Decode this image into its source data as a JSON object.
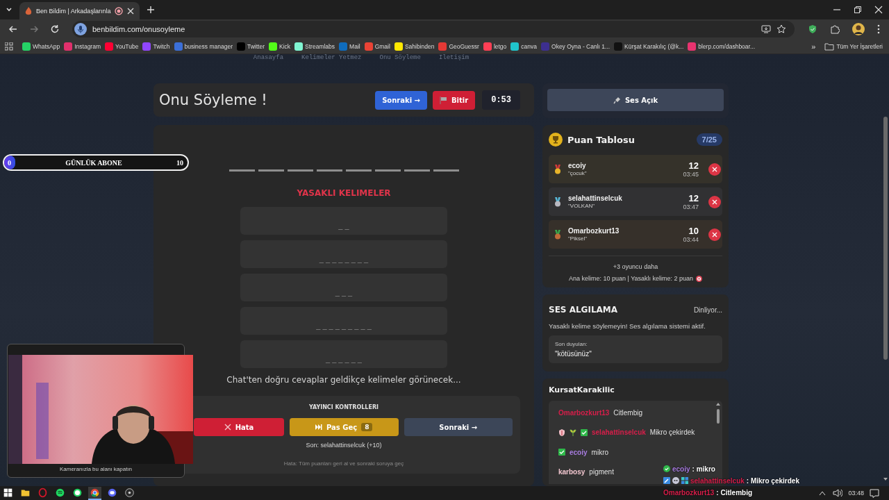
{
  "browser": {
    "tab": {
      "title": "Ben Bildim | Arkadaşlarınla",
      "recording": true
    },
    "address": "benbildim.com/onusoyleme",
    "bookmarks": [
      {
        "label": "WhatsApp",
        "color": "#25d366"
      },
      {
        "label": "Instagram",
        "color": "#e1306c"
      },
      {
        "label": "YouTube",
        "color": "#ff0033"
      },
      {
        "label": "Twitch",
        "color": "#9146ff"
      },
      {
        "label": "business manager",
        "color": "#3b6fd8"
      },
      {
        "label": "Twitter",
        "color": "#000000"
      },
      {
        "label": "Kick",
        "color": "#53fc18"
      },
      {
        "label": "Streamlabs",
        "color": "#80f5d2"
      },
      {
        "label": "Mail",
        "color": "#0f6cbd"
      },
      {
        "label": "Gmail",
        "color": "#ea4335"
      },
      {
        "label": "Sahibinden",
        "color": "#ffe800"
      },
      {
        "label": "GeoGuessr",
        "color": "#e53935"
      },
      {
        "label": "letgo",
        "color": "#ff3f55"
      },
      {
        "label": "canva",
        "color": "#20c4cb"
      },
      {
        "label": "Okey Oyna - Canlı 1...",
        "color": "#3d2f8f"
      },
      {
        "label": "Kürşat Karakılıç (@k...",
        "color": "#111111"
      },
      {
        "label": "blerp.com/dashboar...",
        "color": "#e8336f"
      }
    ],
    "more": "»",
    "all_bookmarks": "Tüm Yer İşaretleri"
  },
  "nav": [
    "Anasayfa",
    "Kelimeler Yetmez",
    "Onu Söyleme",
    "İletişim"
  ],
  "game": {
    "title": "Onu Söyleme !",
    "next_button": "Sonraki →",
    "finish_button": "Bitir",
    "timer": "0:53",
    "letters": [
      {
        "revealed": false
      },
      {
        "revealed": false
      },
      {
        "revealed": false
      },
      {
        "revealed": false
      },
      {
        "revealed": false
      },
      {
        "revealed": false
      },
      {
        "revealed": false
      },
      {
        "revealed": false
      }
    ],
    "forbidden_title": "YASAKLI KELIMELER",
    "forbidden_words": [
      "_ _",
      "_ _ _ _ _ _ _ _",
      "_ _ _",
      "_ _ _ _ _ _ _ _ _",
      "_ _ _ _ _ _"
    ],
    "hint": "Chat'ten doğru cevaplar geldikçe kelimeler görünecek...",
    "controls": {
      "title": "YAYINCI KONTROLLERI",
      "buttons": [
        {
          "kind": "error",
          "label": "Hata"
        },
        {
          "kind": "pass",
          "label": "Pas Geç",
          "count": "8"
        },
        {
          "kind": "next",
          "label": "Sonraki →"
        }
      ],
      "last": "Son: selahattinselcuk (+10)",
      "note": "Hata: Tüm puanları geri al ve sonraki soruya geç"
    }
  },
  "sidebar": {
    "sound_button": "Ses Açık",
    "leaderboard": {
      "title": "Puan Tablosu",
      "count": "7/25",
      "entries": [
        {
          "kind": "gold",
          "name": "ecoiy",
          "word": "\"çocuk\"",
          "score": "12",
          "time": "03:45"
        },
        {
          "kind": "silver",
          "name": "selahattinselcuk",
          "word": "\"VOLKAN\"",
          "score": "12",
          "time": "03:47"
        },
        {
          "kind": "bronze",
          "name": "Omarbozkurt13",
          "word": "\"Piksel\"",
          "score": "10",
          "time": "03:44"
        }
      ],
      "more": "+3 oyuncu daha",
      "rules": "Ana kelime: 10 puan | Yasaklı kelime: 2 puan"
    },
    "voice": {
      "title": "SES ALGILAMA",
      "status": "Dinliyor...",
      "text": "Yasaklı kelime söylemeyin! Ses algılama sistemi aktif.",
      "last_label": "Son duyulan:",
      "last_heard": "\"kötüsünüz\""
    },
    "chat": {
      "title": "KursatKarakilic",
      "messages": [
        {
          "user": "Omarbozkurt13",
          "color": "#d81e4a",
          "text": "Citlembig"
        },
        {
          "user": "selahattinselcuk",
          "color": "#d81e4a",
          "text": "Mikro çekirdek",
          "badges": [
            {
              "kind": "shield"
            },
            {
              "kind": "sprout"
            },
            {
              "kind": "check"
            }
          ]
        },
        {
          "user": "ecoiy",
          "color": "#a87ce0",
          "text": "mikro",
          "badges": [
            {
              "kind": "check"
            }
          ]
        },
        {
          "user": "karbosy",
          "color": "#f2c6cf",
          "text": "pigment"
        }
      ]
    }
  },
  "overlays": {
    "sub_goal": {
      "label": "GÜNLÜK ABONE",
      "start": "0",
      "goal": "10",
      "level": 0.06
    },
    "webcam": {
      "caption": "Kameranızla bu alanı kapatın"
    },
    "stream_chat": [
      {
        "user": "ecoiy",
        "color": "#a87ce0",
        "text": ": mikro",
        "badges": [
          {
            "kind": "dot"
          }
        ]
      },
      {
        "user": "selahattinselcuk",
        "color": "#d81e4a",
        "text": ": Mikro çekirdek",
        "badges": [
          {
            "kind": "tool"
          },
          {
            "kind": "bubble"
          },
          {
            "kind": "grid"
          }
        ]
      },
      {
        "user": "Omarbozkurt13",
        "color": "#d81e4a",
        "text": ": Citlembig"
      }
    ]
  },
  "taskbar": {
    "apps": [
      {
        "kind": "windows",
        "active": false
      },
      {
        "kind": "folder",
        "active": false
      },
      {
        "kind": "opera",
        "active": false
      },
      {
        "kind": "spotify",
        "active": false
      },
      {
        "kind": "whatsapp",
        "active": false
      },
      {
        "kind": "chrome",
        "active": true
      },
      {
        "kind": "discord",
        "active": false
      },
      {
        "kind": "obs",
        "active": false
      }
    ],
    "clock": "03:48"
  }
}
